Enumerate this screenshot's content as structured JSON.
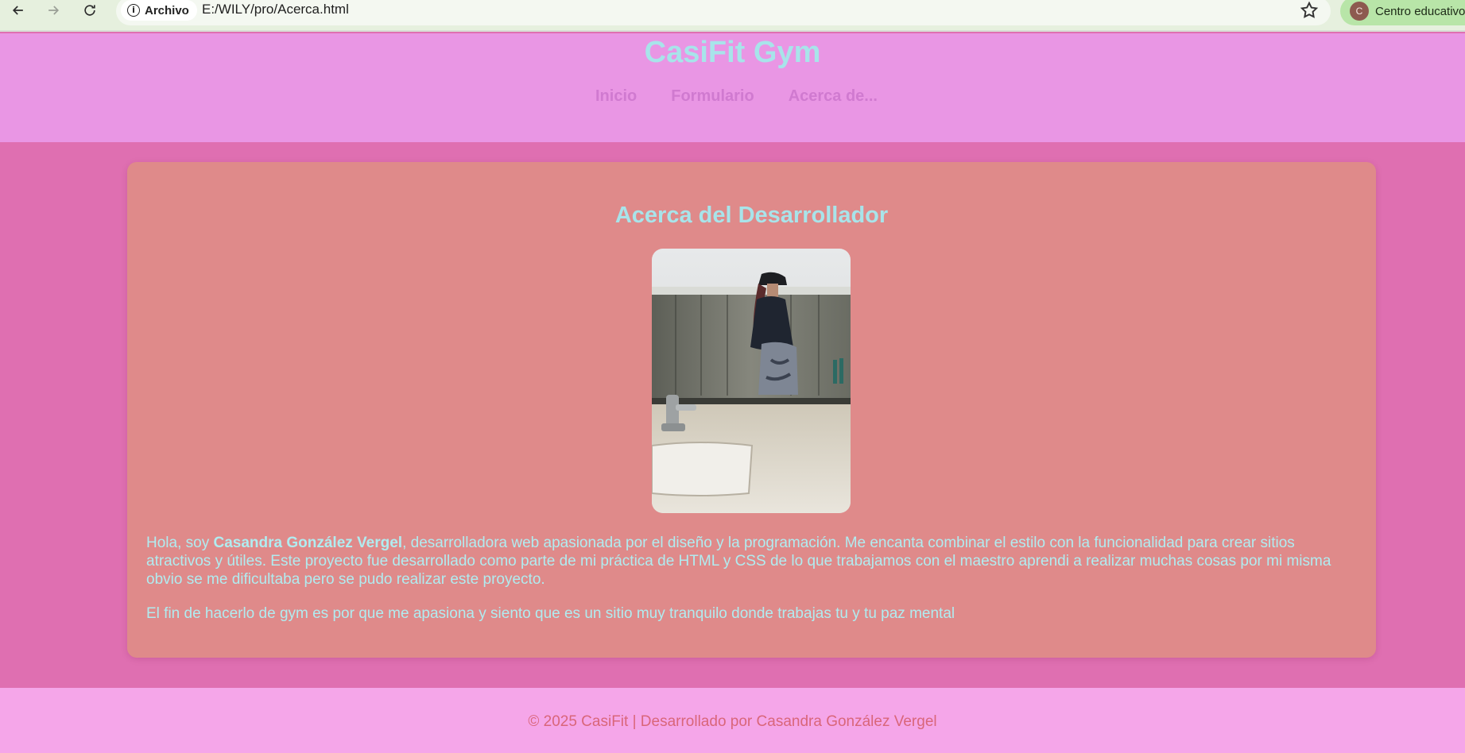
{
  "browser": {
    "site_chip_label": "Archivo",
    "url": "E:/WILY/pro/Acerca.html",
    "profile_initial": "C",
    "profile_label": "Centro educativo"
  },
  "header": {
    "site_title": "CasiFit Gym",
    "nav": [
      "Inicio",
      "Formulario",
      "Acerca de..."
    ]
  },
  "main": {
    "title": "Acerca del Desarrollador",
    "intro_prefix": "Hola, soy ",
    "developer_name": "Casandra González Vergel",
    "intro_suffix": ", desarrolladora web apasionada por el diseño y la programación. Me encanta combinar el estilo con la funcionalidad para crear sitios atractivos y útiles. Este proyecto fue desarrollado como parte de mi práctica de HTML y CSS de lo que trabajamos con el maestro aprendi a realizar muchas cosas por mi misma obvio se me dificultaba pero se pudo realizar este proyecto.",
    "paragraph2": "El fin de hacerlo de gym es por que me apasiona y siento que es un sitio muy tranquilo donde trabajas tu y tu paz mental"
  },
  "footer": {
    "text": "© 2025 CasiFit | Desarrollado por Casandra González Vergel"
  },
  "colors": {
    "header_bg": "#e996e4",
    "body_bg": "#df6fb1",
    "card_bg": "#df8a8a",
    "footer_bg": "#f5a6e9",
    "title_color": "#a8e4ea",
    "nav_color": "#d07ad0",
    "footer_text_color": "#d9667a"
  }
}
